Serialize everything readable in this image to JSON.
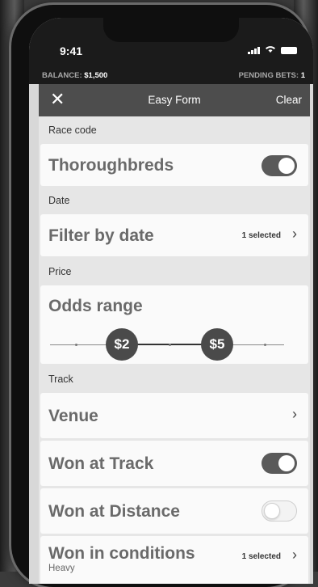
{
  "status_bar": {
    "time": "9:41"
  },
  "account": {
    "balance_label": "BALANCE:",
    "balance_value": "$1,500",
    "pending_label": "PENDING BETS:",
    "pending_value": "1"
  },
  "header": {
    "title": "Easy Form",
    "clear_label": "Clear"
  },
  "sections": {
    "race_code": {
      "label": "Race code",
      "title": "Thoroughbreds",
      "toggle_on": true
    },
    "date": {
      "label": "Date",
      "title": "Filter by date",
      "selected": "1 selected"
    },
    "price": {
      "label": "Price",
      "title": "Odds range",
      "min_label": "$2",
      "max_label": "$5"
    },
    "track": {
      "label": "Track",
      "venue": {
        "title": "Venue"
      },
      "won_at_track": {
        "title": "Won at Track",
        "toggle_on": true
      },
      "won_at_distance": {
        "title": "Won at Distance",
        "toggle_on": false
      },
      "won_in_conditions": {
        "title": "Won in conditions",
        "subtitle": "Heavy",
        "selected": "1 selected"
      }
    }
  }
}
